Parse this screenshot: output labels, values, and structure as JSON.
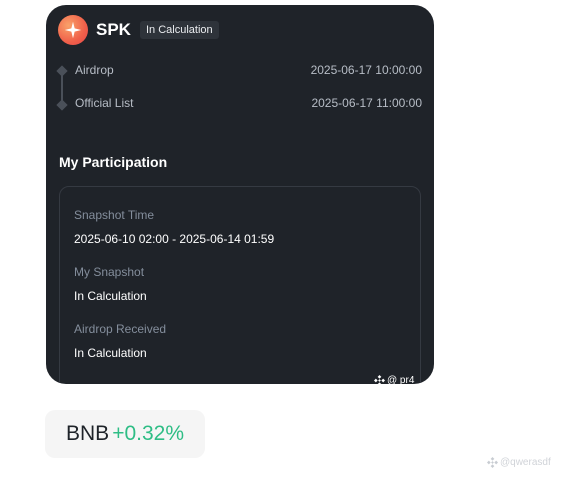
{
  "header": {
    "token_name": "SPK",
    "status": "In Calculation",
    "logo_icon": "sparkle-star-icon",
    "logo_color": "#f0604a"
  },
  "timeline": {
    "items": [
      {
        "label": "Airdrop",
        "date": "2025-06-17 10:00:00"
      },
      {
        "label": "Official List",
        "date": "2025-06-17 11:00:00"
      }
    ]
  },
  "participation": {
    "title": "My Participation",
    "fields": [
      {
        "label": "Snapshot Time",
        "value": "2025-06-10 02:00 - 2025-06-14 01:59"
      },
      {
        "label": "My Snapshot",
        "value": "In Calculation"
      },
      {
        "label": "Airdrop Received",
        "value": "In Calculation"
      }
    ]
  },
  "watermarks": {
    "card": "@ pr4",
    "page": "@qwerasdf"
  },
  "ticker": {
    "symbol": "BNB",
    "change": "+0.32%",
    "change_color": "#2ebd85"
  }
}
